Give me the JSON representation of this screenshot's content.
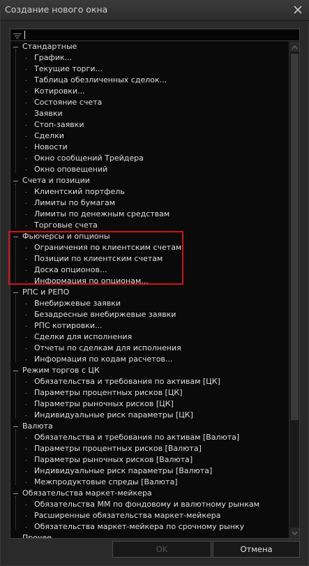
{
  "window": {
    "title": "Создание нового окна"
  },
  "search": {
    "value": ""
  },
  "tree": [
    {
      "label": "Стандартные",
      "items": [
        "График...",
        "Текущие торги...",
        "Таблица обезличенных сделок...",
        "Котировки...",
        "Состояние счета",
        "Заявки",
        "Стоп-заявки",
        "Сделки",
        "Новости",
        "Окно сообщений Трейдера",
        "Окно оповещений"
      ]
    },
    {
      "label": "Счета и позиции",
      "items": [
        "Клиентский портфель",
        "Лимиты по бумагам",
        "Лимиты по денежным средствам",
        "Торговые счета"
      ]
    },
    {
      "label": "Фьючерсы и опционы",
      "items": [
        "Ограничения по клиентским счетам",
        "Позиции по клиентским счетам",
        "Доска опционов...",
        "Информация по опционам..."
      ]
    },
    {
      "label": "РПС и РЕПО",
      "items": [
        "Внебиржевые заявки",
        "Безадресные внебиржевые заявки",
        "РПС котировки...",
        "Сделки для исполнения",
        "Отчеты по сделкам для исполнения",
        "Информация по кодам расчетов..."
      ]
    },
    {
      "label": "Режим торгов с ЦК",
      "items": [
        "Обязательства и требования по активам [ЦК]",
        "Параметры процентных рисков [ЦК]",
        "Параметры рыночных рисков [ЦК]",
        "Индивидуальные риск параметры [ЦК]"
      ]
    },
    {
      "label": "Валюта",
      "items": [
        "Обязательства и требования по активам [Валюта]",
        "Параметры процентных рисков [Валюта]",
        "Параметры рыночных рисков [Валюта]",
        "Индивидуальные риск параметры [Валюта]",
        "Межпродуктовые спреды [Валюта]"
      ]
    },
    {
      "label": "Обязательства маркет-мейкера",
      "items": [
        "Обязательства ММ по фондовому и валютному рынкам",
        "Расширенные обязательства маркет-мейкера",
        "Обязательства маркет-мейкера по срочному рынку"
      ]
    },
    {
      "label": "Прочее",
      "items": []
    }
  ],
  "buttons": {
    "ok": "OK",
    "cancel": "Отмена"
  },
  "colors": {
    "highlight": "#d0141c",
    "background": "#0a0a0a"
  }
}
